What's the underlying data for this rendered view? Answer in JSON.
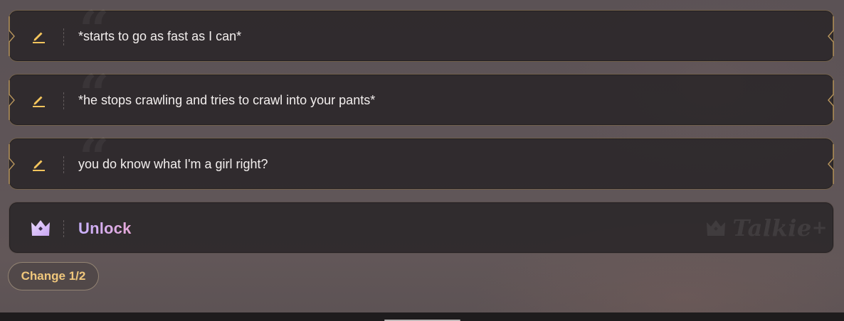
{
  "replies": [
    {
      "text": "*starts to go as fast as I can*",
      "icon": "pencil-icon"
    },
    {
      "text": "*he stops crawling and tries to crawl into your pants*",
      "icon": "pencil-icon"
    },
    {
      "text": "you do know what I'm a girl right?",
      "icon": "pencil-icon"
    }
  ],
  "unlock": {
    "label": "Unlock",
    "icon": "crown-icon"
  },
  "watermark": {
    "text": "Talkie",
    "plus": "+"
  },
  "change_button": {
    "label": "Change 1/2"
  },
  "colors": {
    "accent_gold": "#f0c77c",
    "unlock_gradient_start": "#c9b2ff",
    "unlock_gradient_end": "#e6a8d8",
    "card_bg": "#2c282a",
    "text": "#f3efee"
  }
}
